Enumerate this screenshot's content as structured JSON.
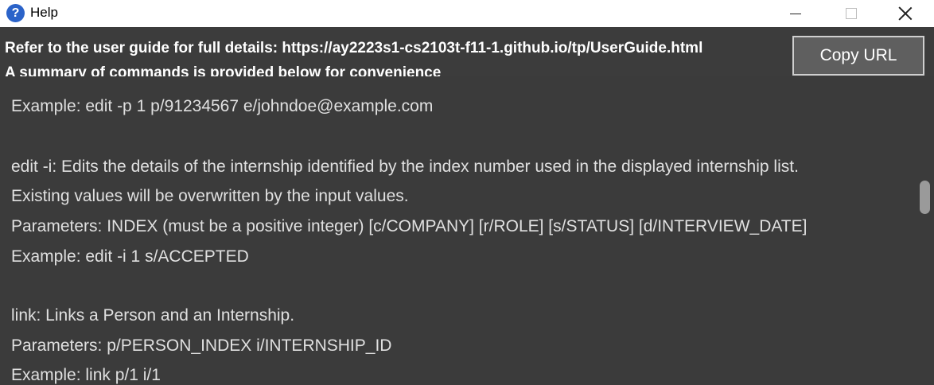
{
  "window": {
    "title": "Help",
    "icon": "help-question-icon"
  },
  "header": {
    "line1": "Refer to the user guide for full details: https://ay2223s1-cs2103t-f11-1.github.io/tp/UserGuide.html",
    "line2": "A summary of commands is provided below for convenience",
    "copy_button_label": "Copy URL"
  },
  "content": {
    "lines": [
      "Example: edit -p 1 p/91234567 e/johndoe@example.com",
      "",
      "edit -i: Edits the details of the internship identified by the index number used in the displayed internship list.",
      "Existing values will be overwritten by the input values.",
      "Parameters: INDEX (must be a positive integer) [c/COMPANY] [r/ROLE] [s/STATUS] [d/INTERVIEW_DATE]",
      "Example: edit -i 1 s/ACCEPTED",
      "",
      "link: Links a Person and an Internship.",
      "Parameters: p/PERSON_INDEX i/INTERNSHIP_ID",
      "Example: link p/1 i/1"
    ]
  },
  "colors": {
    "background": "#3c3c3c",
    "text": "#e0e0e0",
    "button": "#5f5f5f"
  }
}
